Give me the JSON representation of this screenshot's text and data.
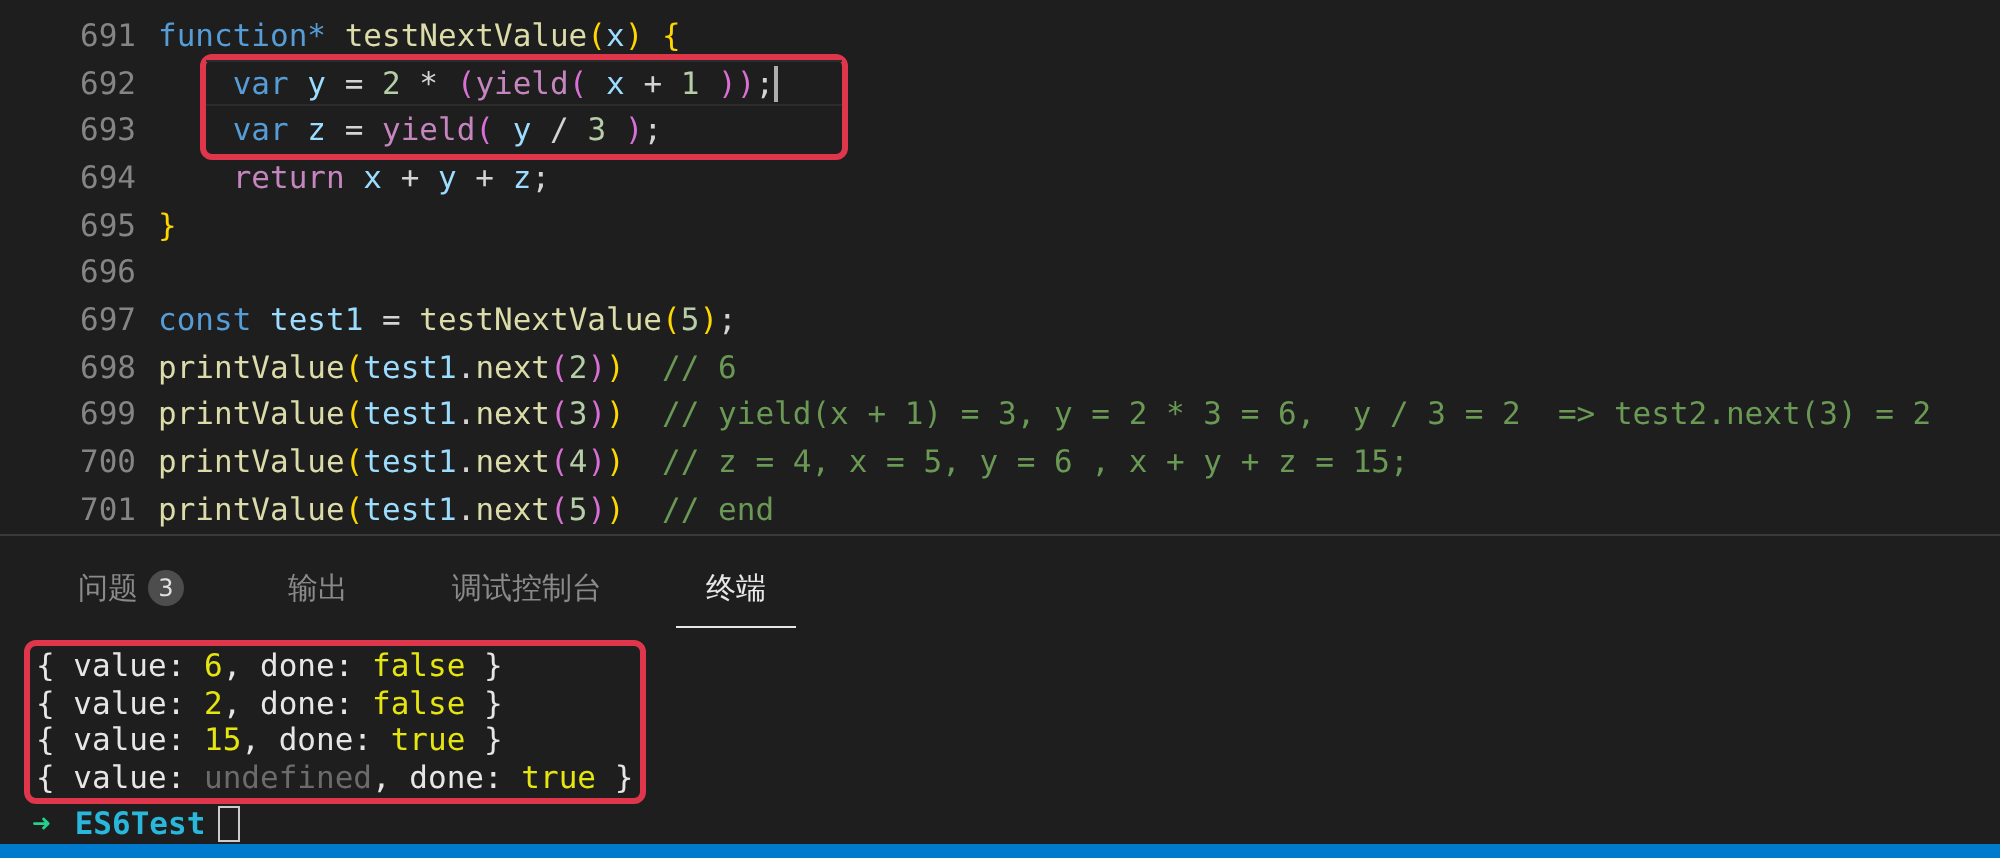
{
  "editor": {
    "lines": [
      {
        "number": "691",
        "boxed": false,
        "current": false,
        "tokens": [
          {
            "kind": "keyword",
            "text": "function* "
          },
          {
            "kind": "func",
            "text": "testNextValue"
          },
          {
            "kind": "bracket1",
            "text": "("
          },
          {
            "kind": "var",
            "text": "x"
          },
          {
            "kind": "bracket1",
            "text": ") {"
          }
        ]
      },
      {
        "number": "692",
        "boxed": true,
        "current": true,
        "tokens": [
          {
            "kind": "keyword",
            "text": "    var "
          },
          {
            "kind": "var",
            "text": "y"
          },
          {
            "kind": "plain",
            "text": " = "
          },
          {
            "kind": "num",
            "text": "2"
          },
          {
            "kind": "plain",
            "text": " * "
          },
          {
            "kind": "bracket2",
            "text": "("
          },
          {
            "kind": "control",
            "text": "yield"
          },
          {
            "kind": "bracket2",
            "text": "( "
          },
          {
            "kind": "var",
            "text": "x"
          },
          {
            "kind": "plain",
            "text": " + "
          },
          {
            "kind": "num",
            "text": "1 "
          },
          {
            "kind": "bracket2",
            "text": "))"
          },
          {
            "kind": "plain",
            "text": ";"
          }
        ]
      },
      {
        "number": "693",
        "boxed": true,
        "current": false,
        "tokens": [
          {
            "kind": "keyword",
            "text": "    var "
          },
          {
            "kind": "var",
            "text": "z"
          },
          {
            "kind": "plain",
            "text": " = "
          },
          {
            "kind": "control",
            "text": "yield"
          },
          {
            "kind": "bracket2",
            "text": "( "
          },
          {
            "kind": "var",
            "text": "y"
          },
          {
            "kind": "plain",
            "text": " / "
          },
          {
            "kind": "num",
            "text": "3 "
          },
          {
            "kind": "bracket2",
            "text": ")"
          },
          {
            "kind": "plain",
            "text": ";"
          }
        ]
      },
      {
        "number": "694",
        "boxed": false,
        "current": false,
        "tokens": [
          {
            "kind": "control",
            "text": "    return "
          },
          {
            "kind": "var",
            "text": "x"
          },
          {
            "kind": "plain",
            "text": " + "
          },
          {
            "kind": "var",
            "text": "y"
          },
          {
            "kind": "plain",
            "text": " + "
          },
          {
            "kind": "var",
            "text": "z"
          },
          {
            "kind": "plain",
            "text": ";"
          }
        ]
      },
      {
        "number": "695",
        "boxed": false,
        "current": false,
        "tokens": [
          {
            "kind": "bracket1",
            "text": "}"
          }
        ]
      },
      {
        "number": "696",
        "boxed": false,
        "current": false
      },
      {
        "number": "697",
        "boxed": false,
        "current": false,
        "tokens": [
          {
            "kind": "keyword",
            "text": "const "
          },
          {
            "kind": "var",
            "text": "test1"
          },
          {
            "kind": "plain",
            "text": " = "
          },
          {
            "kind": "func",
            "text": "testNextValue"
          },
          {
            "kind": "bracket1",
            "text": "("
          },
          {
            "kind": "num",
            "text": "5"
          },
          {
            "kind": "bracket1",
            "text": ")"
          },
          {
            "kind": "plain",
            "text": ";"
          }
        ]
      },
      {
        "number": "698",
        "boxed": false,
        "current": false,
        "tokens": [
          {
            "kind": "func",
            "text": "printValue"
          },
          {
            "kind": "bracket1",
            "text": "("
          },
          {
            "kind": "var",
            "text": "test1"
          },
          {
            "kind": "plain",
            "text": "."
          },
          {
            "kind": "func",
            "text": "next"
          },
          {
            "kind": "bracket2",
            "text": "("
          },
          {
            "kind": "num",
            "text": "2"
          },
          {
            "kind": "bracket2",
            "text": ")"
          },
          {
            "kind": "bracket1",
            "text": ")"
          },
          {
            "kind": "comment",
            "text": "  // 6"
          }
        ]
      },
      {
        "number": "699",
        "boxed": false,
        "current": false,
        "tokens": [
          {
            "kind": "func",
            "text": "printValue"
          },
          {
            "kind": "bracket1",
            "text": "("
          },
          {
            "kind": "var",
            "text": "test1"
          },
          {
            "kind": "plain",
            "text": "."
          },
          {
            "kind": "func",
            "text": "next"
          },
          {
            "kind": "bracket2",
            "text": "("
          },
          {
            "kind": "num",
            "text": "3"
          },
          {
            "kind": "bracket2",
            "text": ")"
          },
          {
            "kind": "bracket1",
            "text": ")"
          },
          {
            "kind": "comment",
            "text": "  // yield(x + 1) = 3, y = 2 * 3 = 6,  y / 3 = 2  => test2.next(3) = 2"
          }
        ]
      },
      {
        "number": "700",
        "boxed": false,
        "current": false,
        "tokens": [
          {
            "kind": "func",
            "text": "printValue"
          },
          {
            "kind": "bracket1",
            "text": "("
          },
          {
            "kind": "var",
            "text": "test1"
          },
          {
            "kind": "plain",
            "text": "."
          },
          {
            "kind": "func",
            "text": "next"
          },
          {
            "kind": "bracket2",
            "text": "("
          },
          {
            "kind": "num",
            "text": "4"
          },
          {
            "kind": "bracket2",
            "text": ")"
          },
          {
            "kind": "bracket1",
            "text": ")"
          },
          {
            "kind": "comment",
            "text": "  // z = 4, x = 5, y = 6 , x + y + z = 15;"
          }
        ]
      },
      {
        "number": "701",
        "boxed": false,
        "current": false,
        "tokens": [
          {
            "kind": "func",
            "text": "printValue"
          },
          {
            "kind": "bracket1",
            "text": "("
          },
          {
            "kind": "var",
            "text": "test1"
          },
          {
            "kind": "plain",
            "text": "."
          },
          {
            "kind": "func",
            "text": "next"
          },
          {
            "kind": "bracket2",
            "text": "("
          },
          {
            "kind": "num",
            "text": "5"
          },
          {
            "kind": "bracket2",
            "text": ")"
          },
          {
            "kind": "bracket1",
            "text": ")"
          },
          {
            "kind": "comment",
            "text": "  // end"
          }
        ]
      }
    ]
  },
  "panel": {
    "tabs": [
      {
        "label": "问题",
        "badge": "3",
        "selected": false
      },
      {
        "label": "输出",
        "selected": false
      },
      {
        "label": "调试控制台",
        "selected": false
      },
      {
        "label": "终端",
        "selected": true
      }
    ],
    "terminal": {
      "output_boxed": true,
      "lines": [
        {
          "tokens": [
            {
              "kind": "plain",
              "text": "{ value: "
            },
            {
              "kind": "value",
              "text": "6"
            },
            {
              "kind": "plain",
              "text": ", done: "
            },
            {
              "kind": "value",
              "text": "false"
            },
            {
              "kind": "plain",
              "text": " }"
            }
          ]
        },
        {
          "tokens": [
            {
              "kind": "plain",
              "text": "{ value: "
            },
            {
              "kind": "value",
              "text": "2"
            },
            {
              "kind": "plain",
              "text": ", done: "
            },
            {
              "kind": "value",
              "text": "false"
            },
            {
              "kind": "plain",
              "text": " }"
            }
          ]
        },
        {
          "tokens": [
            {
              "kind": "plain",
              "text": "{ value: "
            },
            {
              "kind": "value",
              "text": "15"
            },
            {
              "kind": "plain",
              "text": ", done: "
            },
            {
              "kind": "value",
              "text": "true"
            },
            {
              "kind": "plain",
              "text": " }"
            }
          ]
        },
        {
          "tokens": [
            {
              "kind": "plain",
              "text": "{ value: "
            },
            {
              "kind": "dim",
              "text": "undefined"
            },
            {
              "kind": "plain",
              "text": ", done: "
            },
            {
              "kind": "value",
              "text": "true"
            },
            {
              "kind": "plain",
              "text": " }"
            }
          ]
        }
      ],
      "prompt": {
        "arrow": "➜",
        "directory": "ES6Test"
      }
    }
  }
}
